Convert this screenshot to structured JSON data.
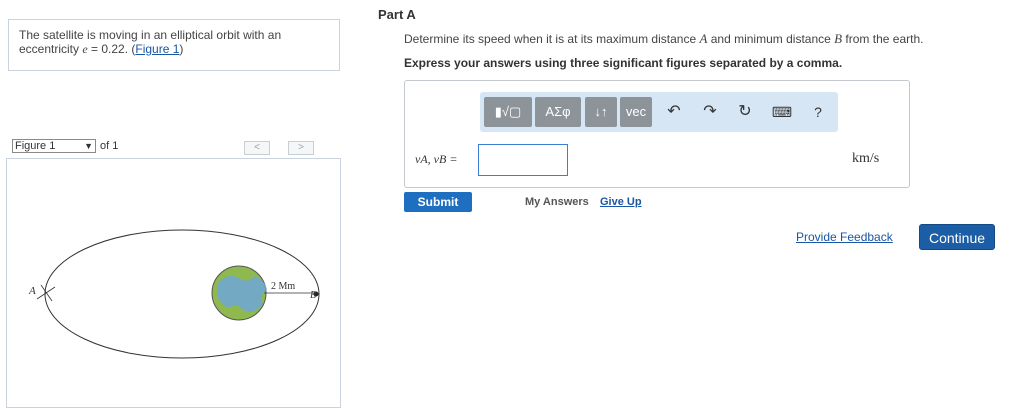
{
  "problem": {
    "text_before": "The satellite is moving in an elliptical orbit with an eccentricity ",
    "var": "e",
    "text_mid": " = 0.22. (",
    "link": "Figure 1",
    "text_after": ")"
  },
  "figure": {
    "select_value": "Figure 1",
    "of_text": "of 1",
    "prev_label": "<",
    "next_label": ">",
    "label_A": "A",
    "label_B": "B",
    "label_dist": "2 Mm"
  },
  "part": {
    "title": "Part A",
    "question_a": "Determine its speed when it is at its maximum distance ",
    "var_A": "A",
    "question_b": " and minimum distance ",
    "var_B": "B",
    "question_c": " from the earth.",
    "instruction": "Express your answers using three significant figures separated by a comma."
  },
  "toolbar": {
    "template_label": "▮√▢",
    "greek_label": "ΑΣφ",
    "arrows_label": "↓↑",
    "vec_label": "vec",
    "undo_icon": "↶",
    "redo_icon": "↷",
    "reset_icon": "↻",
    "keyboard_icon": "⌨",
    "help_label": "?"
  },
  "answer": {
    "label": "vA, vB =",
    "value": "",
    "units": "km/s"
  },
  "actions": {
    "submit": "Submit",
    "my_answers": "My Answers",
    "give_up": "Give Up",
    "feedback": "Provide Feedback",
    "continue": "Continue"
  }
}
